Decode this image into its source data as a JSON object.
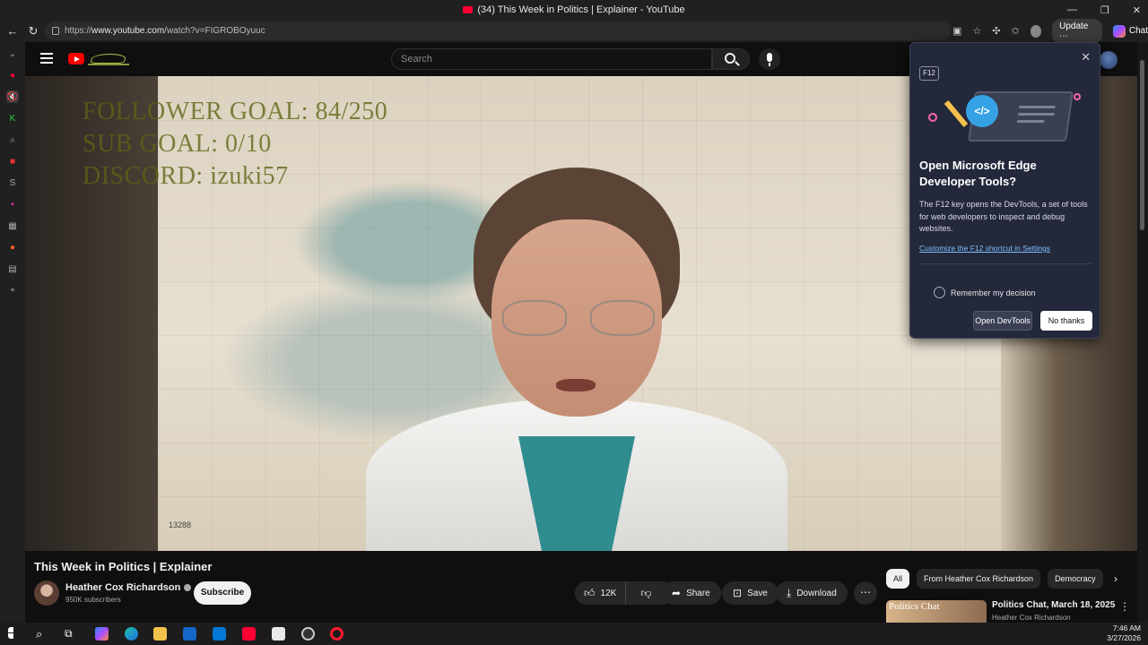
{
  "window": {
    "title": "(34) This Week in Politics | Explainer - YouTube",
    "controls": [
      "—",
      "❐",
      "✕"
    ]
  },
  "browser": {
    "url_scheme": "https://",
    "url_host": "www.youtube.com",
    "url_path": "/watch?v=FIGROBOyuuc",
    "update_label": "Update",
    "chat_label": "Chat"
  },
  "youtube": {
    "search_placeholder": "Search",
    "brand_color": "#ff0000"
  },
  "video": {
    "overlay_lines": [
      "FOLLOWER GOAL: 84/250",
      "SUB GOAL: 0/10",
      "DISCORD: izuki57"
    ],
    "chart_number": "13288",
    "title": "This Week in Politics | Explainer",
    "channel_name": "Heather Cox Richardson",
    "subscribers": "950K subscribers",
    "subscribe_label": "Subscribe",
    "likes": "12K",
    "share_label": "Share",
    "save_label": "Save",
    "download_label": "Download"
  },
  "chips": [
    "All",
    "From Heather Cox Richardson",
    "Democracy"
  ],
  "recommendation": {
    "thumb_text": "Politics Chat",
    "title": "Politics Chat, March 18, 2025",
    "channel": "Heather Cox Richardson"
  },
  "devtools_popup": {
    "key_label": "F12",
    "title": "Open Microsoft Edge Developer Tools?",
    "description": "The F12 key opens the DevTools, a set of tools for web developers to inspect and debug websites.",
    "link": "Customize the F12 shortcut in Settings",
    "checkbox_label": "Remember my decision",
    "open_button": "Open DevTools",
    "decline_button": "No thanks",
    "accent_color": "#7cc1ff"
  },
  "taskbar": {
    "time": "7:46 AM",
    "date": "3/27/2026"
  }
}
